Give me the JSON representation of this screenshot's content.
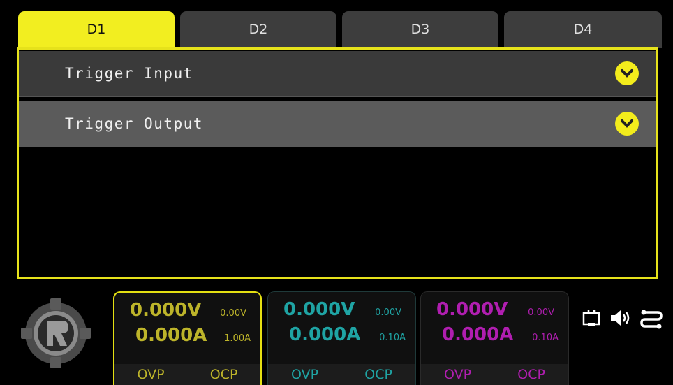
{
  "tabs": [
    {
      "label": "D1",
      "active": true
    },
    {
      "label": "D2",
      "active": false
    },
    {
      "label": "D3",
      "active": false
    },
    {
      "label": "D4",
      "active": false
    }
  ],
  "menu": {
    "trigger_input": "Trigger Input",
    "trigger_output": "Trigger Output"
  },
  "channels": [
    {
      "voltage": "0.000V",
      "current": "0.000A",
      "set_voltage": "0.00V",
      "set_current": "1.00A",
      "ovp": "OVP",
      "ocp": "OCP",
      "color": "#bdb42a"
    },
    {
      "voltage": "0.000V",
      "current": "0.000A",
      "set_voltage": "0.00V",
      "set_current": "0.10A",
      "ovp": "OVP",
      "ocp": "OCP",
      "color": "#1fa4a4"
    },
    {
      "voltage": "0.000V",
      "current": "0.000A",
      "set_voltage": "0.00V",
      "set_current": "0.10A",
      "ovp": "OVP",
      "ocp": "OCP",
      "color": "#b01eb0"
    }
  ],
  "status_icons": [
    "interface-icon",
    "speaker-icon",
    "connection-icon"
  ],
  "accent": "#f2ee20"
}
